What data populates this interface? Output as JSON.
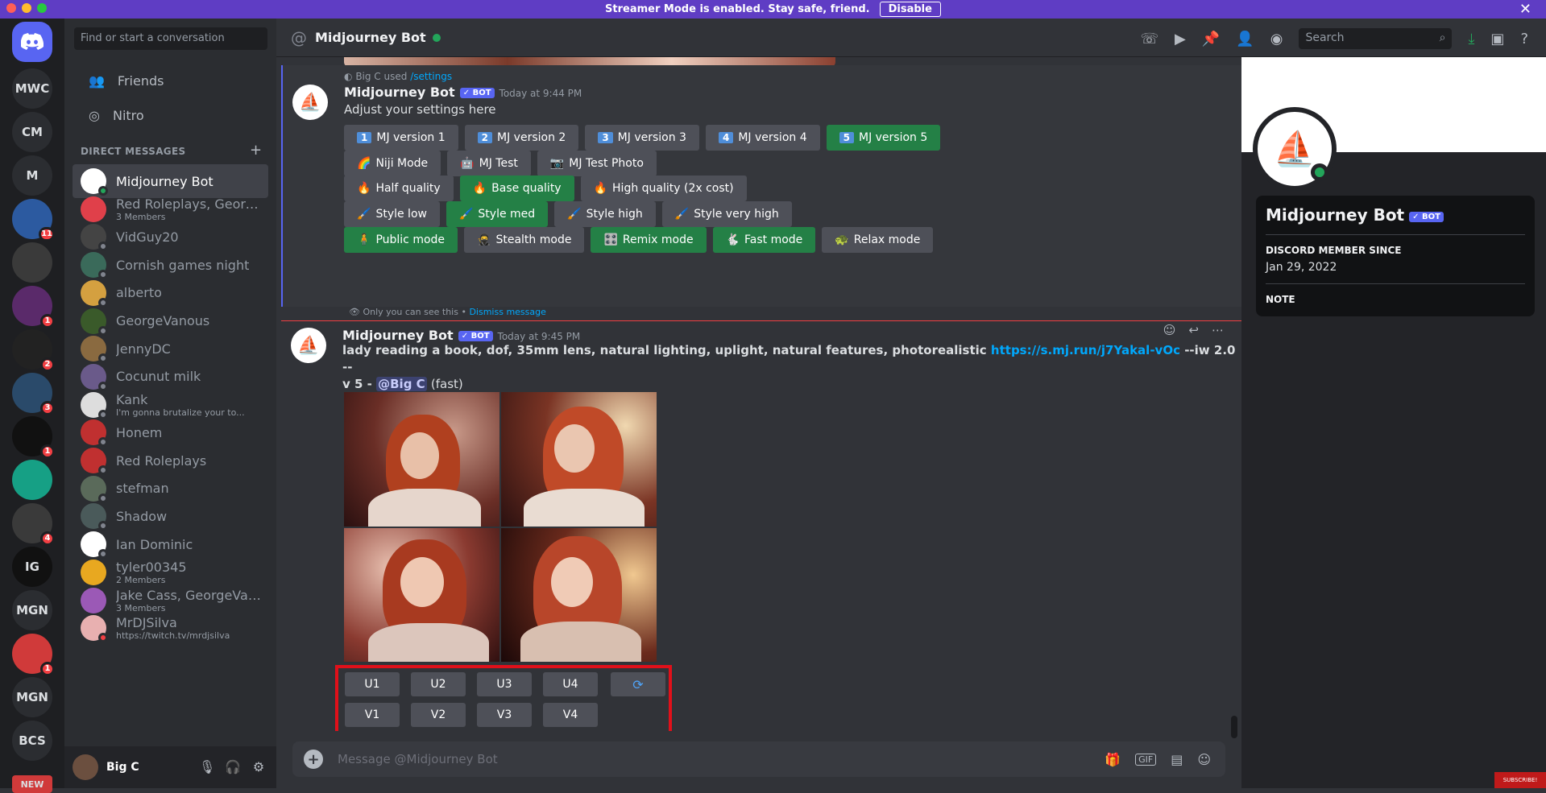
{
  "banner": {
    "text": "Streamer Mode is enabled. Stay safe, friend.",
    "button": "Disable"
  },
  "servers": [
    {
      "label": "MWC"
    },
    {
      "label": "CM"
    },
    {
      "label": "M"
    },
    {
      "label": "",
      "badge": "11"
    },
    {
      "label": ""
    },
    {
      "label": "",
      "badge": "1"
    },
    {
      "label": "",
      "badge": "2"
    },
    {
      "label": "",
      "badge": "3"
    },
    {
      "label": "",
      "badge": "1"
    },
    {
      "label": ""
    },
    {
      "label": "",
      "badge": "4"
    },
    {
      "label": "IG"
    },
    {
      "label": "MGN"
    },
    {
      "label": "",
      "badge": "1"
    },
    {
      "label": "MGN"
    },
    {
      "label": "BCS"
    },
    {
      "label": "NEW"
    }
  ],
  "sidebar": {
    "search_placeholder": "Find or start a conversation",
    "friends": "Friends",
    "nitro": "Nitro",
    "dm_header": "DIRECT MESSAGES",
    "dms": [
      {
        "name": "Midjourney Bot",
        "sub": ""
      },
      {
        "name": "Red Roleplays, Georg...",
        "sub": "3 Members"
      },
      {
        "name": "VidGuy20",
        "sub": ""
      },
      {
        "name": "Cornish games night",
        "sub": ""
      },
      {
        "name": "alberto",
        "sub": ""
      },
      {
        "name": "GeorgeVanous",
        "sub": ""
      },
      {
        "name": "JennyDC",
        "sub": ""
      },
      {
        "name": "Cocunut milk",
        "sub": ""
      },
      {
        "name": "Kank",
        "sub": "I'm gonna brutalize your to..."
      },
      {
        "name": "Honem",
        "sub": ""
      },
      {
        "name": "Red Roleplays",
        "sub": ""
      },
      {
        "name": "stefman",
        "sub": ""
      },
      {
        "name": "Shadow",
        "sub": ""
      },
      {
        "name": "Ian Dominic",
        "sub": ""
      },
      {
        "name": "tyler00345",
        "sub": "2 Members"
      },
      {
        "name": "Jake Cass, GeorgeVan...",
        "sub": "3 Members"
      },
      {
        "name": "MrDJSilva",
        "sub": "https://twitch.tv/mrdjsilva"
      }
    ],
    "user": "Big C"
  },
  "topbar": {
    "title": "Midjourney Bot",
    "search": "Search"
  },
  "ephemeral": {
    "used_by": "Big C used",
    "command": "/settings",
    "author": "Midjourney Bot",
    "bot_tag": "BOT",
    "time": "Today at 9:44 PM",
    "text": "Adjust your settings here",
    "rows": [
      [
        {
          "n": "1",
          "label": "MJ version 1"
        },
        {
          "n": "2",
          "label": "MJ version 2"
        },
        {
          "n": "3",
          "label": "MJ version 3"
        },
        {
          "n": "4",
          "label": "MJ version 4"
        },
        {
          "n": "5",
          "label": "MJ version 5",
          "active": true
        }
      ],
      [
        {
          "e": "🌈",
          "label": "Niji Mode"
        },
        {
          "e": "🤖",
          "label": "MJ Test"
        },
        {
          "e": "📷",
          "label": "MJ Test Photo"
        }
      ],
      [
        {
          "e": "🔥",
          "label": "Half quality"
        },
        {
          "e": "🔥",
          "label": "Base quality",
          "active": true
        },
        {
          "e": "🔥",
          "label": "High quality (2x cost)"
        }
      ],
      [
        {
          "e": "🖌️",
          "label": "Style low"
        },
        {
          "e": "🖌️",
          "label": "Style med",
          "active": true
        },
        {
          "e": "🖌️",
          "label": "Style high"
        },
        {
          "e": "🖌️",
          "label": "Style very high"
        }
      ],
      [
        {
          "e": "🧍",
          "label": "Public mode",
          "active": true
        },
        {
          "e": "🥷",
          "label": "Stealth mode"
        },
        {
          "e": "🎛️",
          "label": "Remix mode",
          "active": true
        },
        {
          "e": "🐇",
          "label": "Fast mode",
          "active": true
        },
        {
          "e": "🐢",
          "label": "Relax mode"
        }
      ]
    ],
    "only_you": "Only you can see this •",
    "dismiss": "Dismiss message"
  },
  "message": {
    "author": "Midjourney Bot",
    "bot_tag": "BOT",
    "time": "Today at 9:45 PM",
    "prompt": "lady reading a book, dof, 35mm lens, natural lighting, uplight, natural features, photorealistic",
    "link": "https://s.mj.run/j7Yakal-vOc",
    "suffix": "--iw 2.0 --",
    "line2": "v 5 -",
    "mention": "@Big C",
    "speed": "(fast)",
    "upscale": [
      "U1",
      "U2",
      "U3",
      "U4"
    ],
    "variation": [
      "V1",
      "V2",
      "V3",
      "V4"
    ]
  },
  "composer": {
    "placeholder": "Message @Midjourney Bot"
  },
  "profile": {
    "name": "Midjourney Bot",
    "bot_tag": "BOT",
    "member_since_label": "DISCORD MEMBER SINCE",
    "member_since": "Jan 29, 2022",
    "note_label": "NOTE"
  },
  "subscribe": "SUBSCRIBE!",
  "colors": {
    "blurple": "#5865f2",
    "green": "#248046",
    "highlight": "#e0101a"
  }
}
